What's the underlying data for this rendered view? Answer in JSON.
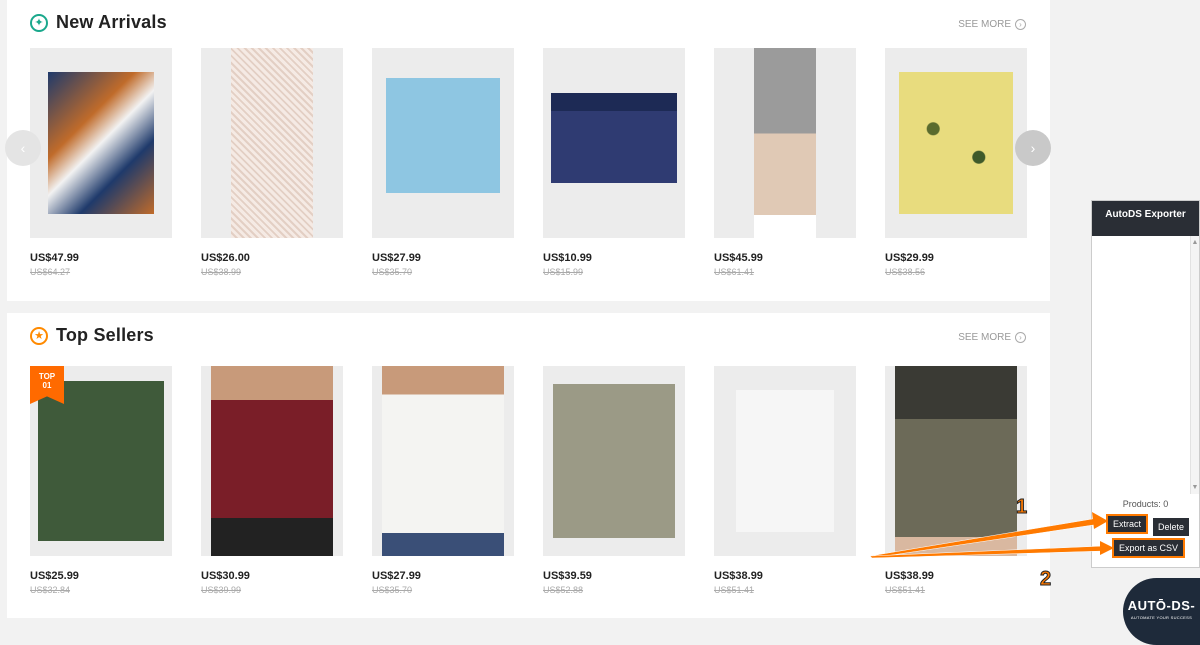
{
  "new_arrivals": {
    "title": "New Arrivals",
    "see_more": "SEE MORE",
    "icon": "sparkle-icon",
    "icon_color": "#1aa88c",
    "products": [
      {
        "price": "US$47.99",
        "old_price": "US$64.27",
        "image": "floral-pants"
      },
      {
        "price": "US$26.00",
        "old_price": "US$38.99",
        "image": "white-mesh-pants"
      },
      {
        "price": "US$27.99",
        "old_price": "US$35.70",
        "image": "blue-henley-tee"
      },
      {
        "price": "US$10.99",
        "old_price": "US$15.99",
        "image": "boxer-briefs"
      },
      {
        "price": "US$45.99",
        "old_price": "US$61.41",
        "image": "grey-shorts"
      },
      {
        "price": "US$29.99",
        "old_price": "US$38.56",
        "image": "yellow-print-shirt"
      }
    ]
  },
  "top_sellers": {
    "title": "Top Sellers",
    "see_more": "SEE MORE",
    "icon": "star-icon",
    "icon_color": "#ff8a00",
    "badge": {
      "line1": "TOP",
      "line2": "01"
    },
    "products": [
      {
        "price": "US$25.99",
        "old_price": "US$32.84",
        "image": "green-linen-shirt"
      },
      {
        "price": "US$30.99",
        "old_price": "US$39.99",
        "image": "burgundy-mandarin-shirt"
      },
      {
        "price": "US$27.99",
        "old_price": "US$35.70",
        "image": "white-linen-shirt"
      },
      {
        "price": "US$39.59",
        "old_price": "US$52.88",
        "image": "khaki-utility-vest"
      },
      {
        "price": "US$38.99",
        "old_price": "US$51.41",
        "image": "brown-hooded-robe"
      },
      {
        "price": "US$38.99",
        "old_price": "US$51.41",
        "image": "olive-linen-pants"
      }
    ]
  },
  "carousel": {
    "prev": "‹",
    "next": "›"
  },
  "exporter": {
    "title": "AutoDS Exporter",
    "products_count": "Products: 0",
    "extract": "Extract",
    "delete": "Delete",
    "export_csv": "Export as CSV",
    "step1": "1",
    "step2": "2",
    "accent": "#ff7a00"
  },
  "logo": {
    "main": "AUTŌ-DS-",
    "sub": "AUTOMATE YOUR SUCCESS"
  }
}
